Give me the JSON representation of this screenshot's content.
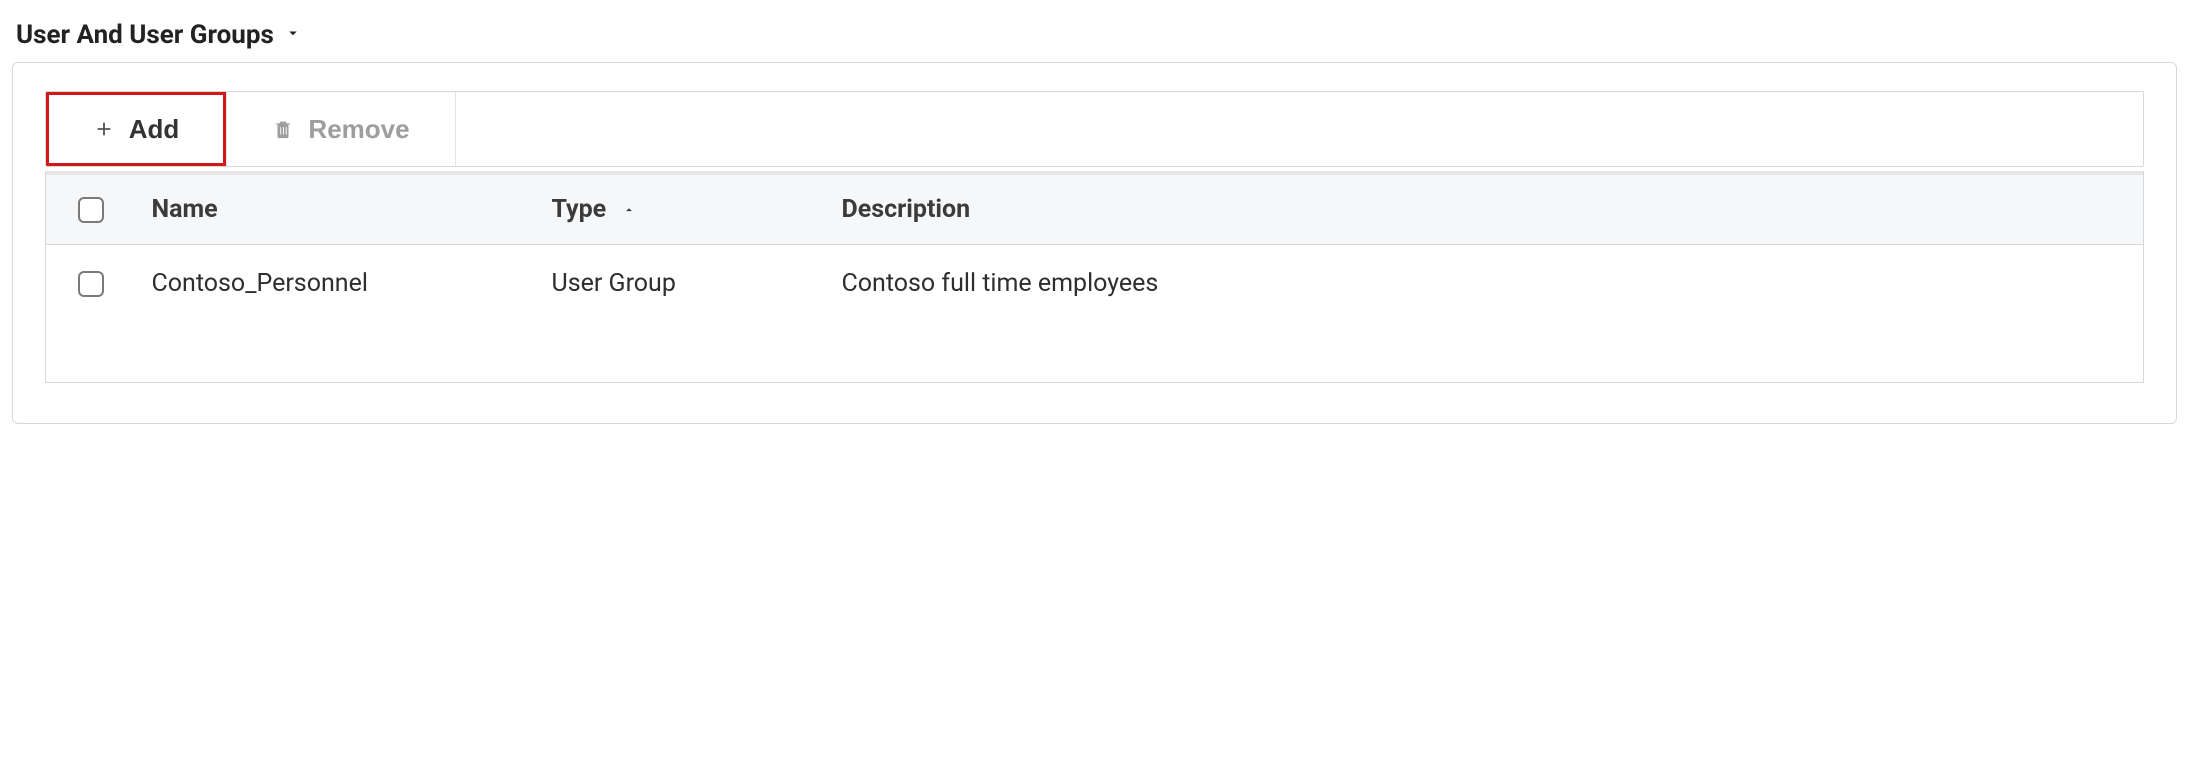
{
  "section": {
    "title": "User And User Groups"
  },
  "toolbar": {
    "add_label": "Add",
    "remove_label": "Remove"
  },
  "table": {
    "columns": {
      "name": "Name",
      "type": "Type",
      "description": "Description"
    },
    "rows": [
      {
        "name": "Contoso_Personnel",
        "type": "User Group",
        "description": "Contoso full time employees"
      }
    ]
  }
}
